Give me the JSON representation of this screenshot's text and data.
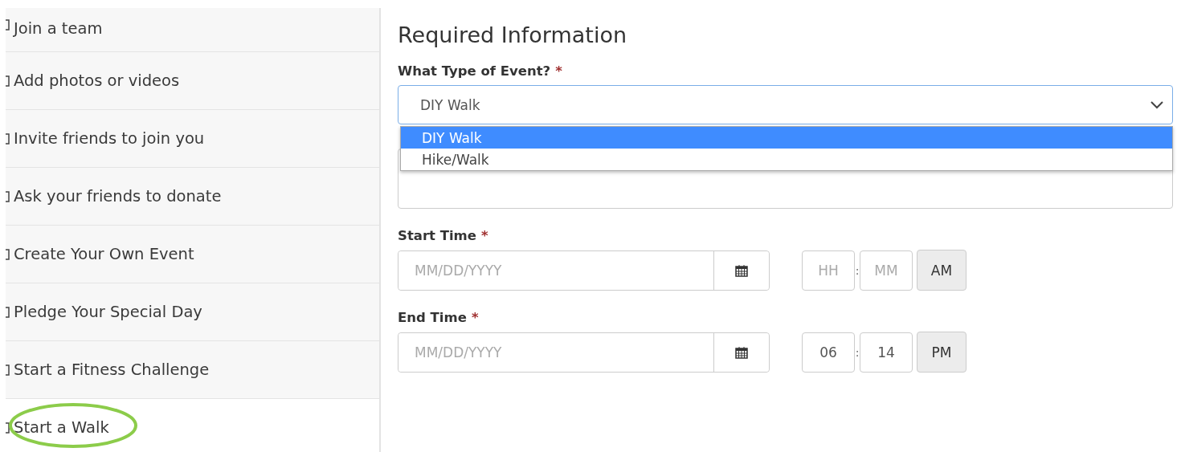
{
  "sidebar": {
    "items": [
      {
        "label": "Join a team",
        "circled": false
      },
      {
        "label": "Add photos or videos",
        "circled": false
      },
      {
        "label": "Invite friends to join you",
        "circled": false
      },
      {
        "label": "Ask your friends to donate",
        "circled": false
      },
      {
        "label": "Create Your Own Event",
        "circled": false
      },
      {
        "label": "Pledge Your Special Day",
        "circled": false
      },
      {
        "label": "Start a Fitness Challenge",
        "circled": false
      },
      {
        "label": "Start a Walk",
        "circled": true
      }
    ]
  },
  "form": {
    "title": "Required Information",
    "event_type": {
      "label": "What Type of Event?",
      "required_mark": "*",
      "value": "DIY Walk",
      "expanded": true,
      "options": [
        {
          "label": "DIY Walk",
          "selected": true
        },
        {
          "label": "Hike/Walk",
          "selected": false
        }
      ]
    },
    "start_time": {
      "label": "Start Time",
      "required_mark": "*",
      "date_placeholder": "MM/DD/YYYY",
      "hour_placeholder": "HH",
      "minute_placeholder": "MM",
      "separator": ":",
      "meridiem": "AM"
    },
    "end_time": {
      "label": "End Time",
      "required_mark": "*",
      "date_placeholder": "MM/DD/YYYY",
      "hour": "06",
      "minute": "14",
      "separator": ":",
      "meridiem": "PM"
    }
  }
}
